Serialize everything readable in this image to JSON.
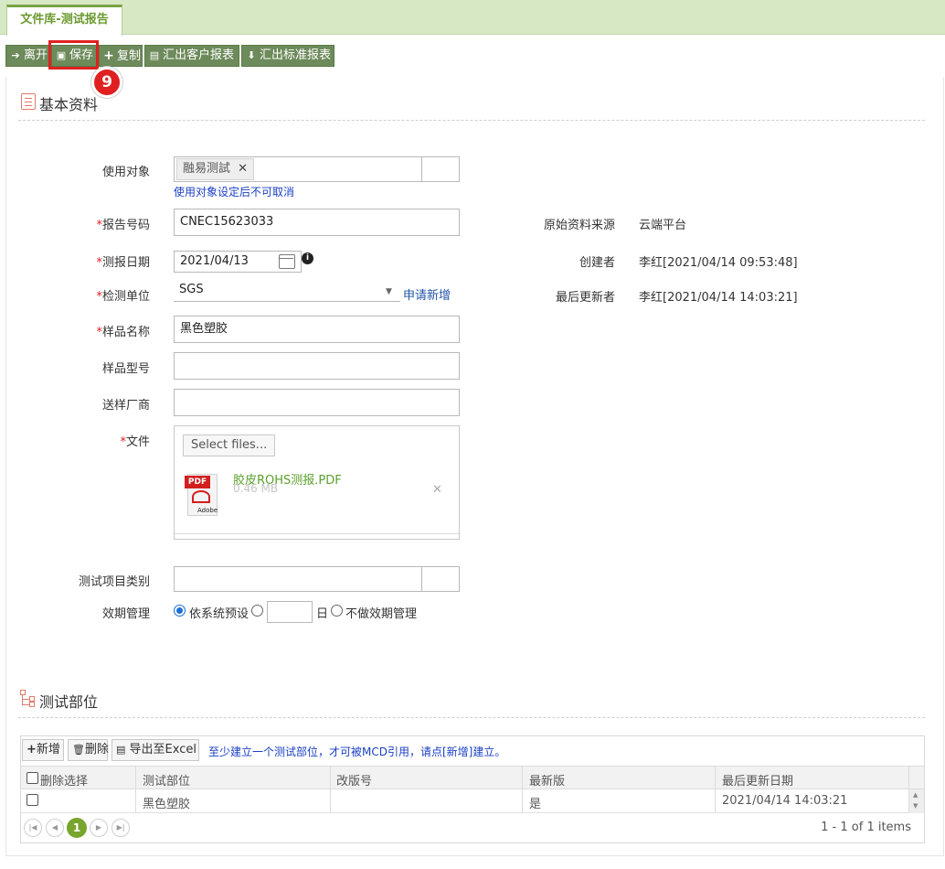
{
  "tab": {
    "label": "文件库-测试报告"
  },
  "toolbar": {
    "leave": "离开",
    "save": "保存",
    "copy": "复制",
    "export_client": "汇出客户报表",
    "export_standard": "汇出标准报表"
  },
  "marker": {
    "step": "9"
  },
  "basic": {
    "title": "基本资料",
    "target_label": "使用对象",
    "target_chip": "融易测試",
    "target_hint": "使用对象设定后不可取消",
    "report_no_label": "报告号码",
    "report_no": "CNEC15623033",
    "report_date_label": "测报日期",
    "report_date": "2021/04/13",
    "lab_label": "检测单位",
    "lab": "SGS",
    "lab_apply": "申请新增",
    "sample_name_label": "样品名称",
    "sample_name": "黑色塑胶",
    "sample_model_label": "样品型号",
    "sample_model": "",
    "supplier_label": "送样厂商",
    "supplier": "",
    "file_label": "文件",
    "select_files": "Select files...",
    "file_name": "胶皮ROHS测报.PDF",
    "file_size": "0.46 MB",
    "pdf_badge": "PDF",
    "pdf_brand": "Adobe",
    "test_category_label": "测试项目类别",
    "validity_label": "效期管理",
    "validity_default": "依系统预设",
    "validity_day_unit": "日",
    "validity_none": "不做效期管理",
    "source_label": "原始资料来源",
    "source": "云端平台",
    "creator_label": "创建者",
    "creator": "李红[2021/04/14 09:53:48]",
    "updater_label": "最后更新者",
    "updater": "李红[2021/04/14 14:03:21]"
  },
  "parts": {
    "title": "测试部位",
    "add": "新增",
    "delete": "删除",
    "export_excel": "导出至Excel",
    "hint": "至少建立一个测试部位，才可被MCD引用，请点[新增]建立。",
    "columns": [
      "删除选择",
      "测试部位",
      "改版号",
      "最新版",
      "最后更新日期"
    ],
    "rows": [
      {
        "part": "黑色塑胶",
        "revision": "",
        "latest": "是",
        "updated": "2021/04/14 14:03:21"
      }
    ],
    "page": "1",
    "summary": "1 - 1 of 1 items"
  }
}
